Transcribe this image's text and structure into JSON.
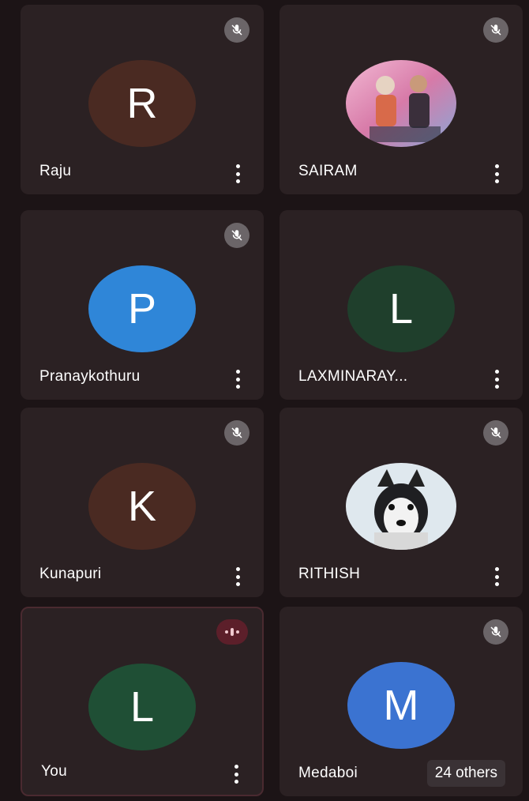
{
  "participants": [
    {
      "name": "Raju",
      "initial": "R",
      "avatar_color": "#4a2a22",
      "muted": true
    },
    {
      "name": "SAIRAM",
      "initial": "",
      "avatar_color": "#d87aa8",
      "muted": true,
      "photo": "people-photo"
    },
    {
      "name": "Pranaykothuru",
      "initial": "P",
      "avatar_color": "#2f86d8",
      "muted": true
    },
    {
      "name": "LAXMINARAY...",
      "initial": "L",
      "avatar_color": "#1f3f2c",
      "muted": false
    },
    {
      "name": "Kunapuri",
      "initial": "K",
      "avatar_color": "#4a2a22",
      "muted": true
    },
    {
      "name": "RITHISH",
      "initial": "",
      "avatar_color": "#dfe8ee",
      "muted": true,
      "photo": "husky-photo"
    },
    {
      "name": "You",
      "initial": "L",
      "avatar_color": "#1f4f35",
      "speaking": true
    },
    {
      "name": "Medaboi",
      "initial": "M",
      "avatar_color": "#3b73d1",
      "muted": true
    }
  ],
  "others_label": "24 others",
  "icons": {
    "mute": "mic-off-icon",
    "more": "more-vert-icon",
    "speaking": "audio-level-icon"
  }
}
